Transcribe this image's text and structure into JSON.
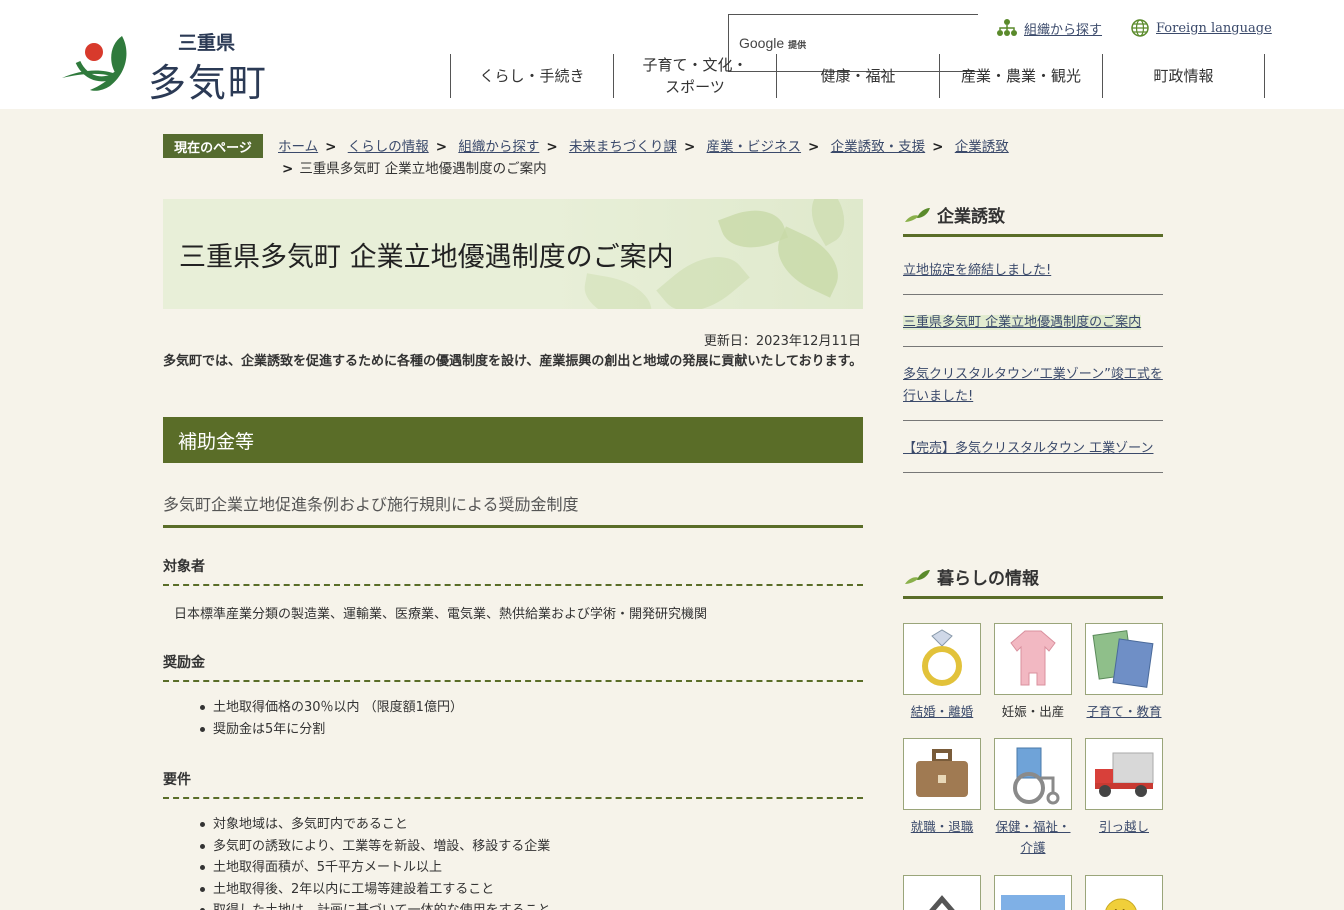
{
  "header": {
    "pref": "三重県",
    "town": "多気町",
    "search_provider": "Google",
    "search_provider_suffix": "提供",
    "links": {
      "org": "組織から探す",
      "foreign": "Foreign language"
    },
    "nav": [
      "くらし・手続き",
      "子育て・文化・\nスポーツ",
      "健康・福祉",
      "産業・農業・観光",
      "町政情報"
    ]
  },
  "breadcrumb": {
    "label": "現在のページ",
    "items": [
      "ホーム",
      "くらしの情報",
      "組織から探す",
      "未来まちづくり課",
      "産業・ビジネス",
      "企業誘致・支援",
      "企業誘致"
    ],
    "current": "三重県多気町 企業立地優遇制度のご案内",
    "sep": ">"
  },
  "main": {
    "title": "三重県多気町 企業立地優遇制度のご案内",
    "updated": "更新日：2023年12月11日",
    "intro": "多気町では、企業誘致を促進するために各種の優遇制度を設け、産業振興の創出と地域の発展に貢献いたしております。",
    "h2": "補助金等",
    "h3": "多気町企業立地促進条例および施行規則による奨励金制度",
    "sections": {
      "target_title": "対象者",
      "target_text": "日本標準産業分類の製造業、運輸業、医療業、電気業、熱供給業および学術・開発研究機関",
      "grant_title": "奨励金",
      "grant_items": [
        "土地取得価格の30％以内 （限度額1億円）",
        "奨励金は5年に分割"
      ],
      "req_title": "要件",
      "req_items": [
        "対象地域は、多気町内であること",
        "多気町の誘致により、工業等を新設、増設、移設する企業",
        "土地取得面積が、5千平方メートル以上",
        "土地取得後、2年以内に工場等建設着工すること",
        "取得した土地は、計画に基づいて一体的な使用をすること"
      ]
    }
  },
  "sidebar": {
    "section1_title": "企業誘致",
    "links": [
      "立地協定を締結しました!",
      "三重県多気町 企業立地優遇制度のご案内",
      "多気クリスタルタウン“工業ゾーン”竣工式を行いました!",
      "【完売】多気クリスタルタウン 工業ゾーン"
    ],
    "section2_title": "暮らしの情報",
    "tiles": [
      {
        "label": "結婚・離婚",
        "icon": "ring-icon",
        "link": true
      },
      {
        "label": "妊娠・出産",
        "icon": "baby-clothes-icon",
        "link": false
      },
      {
        "label": "子育て・教育",
        "icon": "notebooks-icon",
        "link": true
      },
      {
        "label": "就職・退職",
        "icon": "briefcase-icon",
        "link": true
      },
      {
        "label": "保健・福祉・介護",
        "icon": "wheelchair-icon",
        "link": true
      },
      {
        "label": "引っ越し",
        "icon": "truck-icon",
        "link": true
      }
    ]
  },
  "colors": {
    "accent": "#5a6d28",
    "bg": "#f6f3ea",
    "link": "#3b4a6b"
  }
}
